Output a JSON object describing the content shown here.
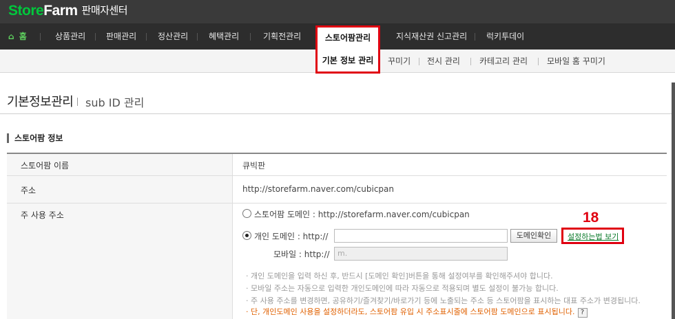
{
  "brand": {
    "store": "Store",
    "farm": "Farm",
    "center": "판매자센터"
  },
  "gnb": {
    "home": "홈",
    "items": [
      "상품관리",
      "판매관리",
      "정산관리",
      "혜택관리",
      "기획전관리",
      "스토어팜관리",
      "지식재산권 신고관리",
      "럭키투데이"
    ]
  },
  "lnb": {
    "items": [
      "기본 정보 관리",
      "꾸미기",
      "전시 관리",
      "카테고리 관리",
      "모바일 홈 꾸미기"
    ]
  },
  "page": {
    "title": "기본정보관리",
    "subtitle": "sub ID 관리"
  },
  "section": {
    "title": "스토어팜 정보"
  },
  "rows": {
    "store_name": {
      "label": "스토어팜 이름",
      "value": "큐빅판"
    },
    "address": {
      "label": "주소",
      "value": "http://storefarm.naver.com/cubicpan"
    },
    "main_address": {
      "label": "주 사용 주소",
      "option_store": "스토어팜 도메인 : http://storefarm.naver.com/cubicpan",
      "option_personal": "개인 도메인 : http://",
      "check_button": "도메인확인",
      "guide_link": "설정하는법 보기",
      "mobile_label": "모바일 : http://",
      "mobile_placeholder": "m.",
      "annotation": "18"
    }
  },
  "notes": [
    "· 개인 도메인을 입력 하신 후, 반드시 [도메인 확인]버튼을 통해 설정여부를 확인해주셔야 합니다.",
    "· 모바일 주소는 자동으로 입력한 개인도메인에 따라 자동으로 적용되며 별도 설정이 불가능 합니다.",
    "· 주 사용 주소를 변경하면, 공유하기/즐겨찾기/바로가기 등에 노출되는 주소 등 스토어팜을 표시하는 대표 주소가 변경됩니다.",
    "· 단, 개인도메인 사용을 설정하더라도, 스토어팜 유입 시 주소표시줄에 스토어팜 도메인으로 표시됩니다."
  ],
  "help_icon": "?",
  "colors": {
    "brand_green": "#00c73c",
    "highlight_red": "#e00010",
    "warn_orange": "#e06000"
  }
}
